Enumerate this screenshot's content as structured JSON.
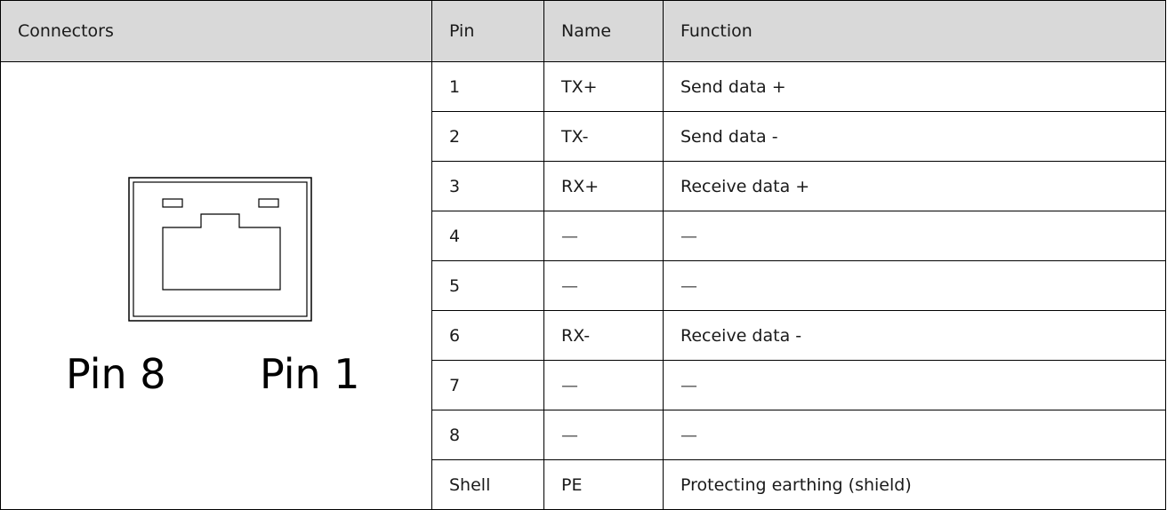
{
  "table": {
    "headers": {
      "connectors": "Connectors",
      "pin": "Pin",
      "name": "Name",
      "function": "Function"
    },
    "connector_labels": {
      "left": "Pin 8",
      "right": "Pin 1"
    },
    "rows": [
      {
        "pin": "1",
        "name": "TX+",
        "function": "Send data +"
      },
      {
        "pin": "2",
        "name": "TX-",
        "function": "Send data -"
      },
      {
        "pin": "3",
        "name": "RX+",
        "function": "Receive data +"
      },
      {
        "pin": "4",
        "name": "—",
        "function": "—"
      },
      {
        "pin": "5",
        "name": "—",
        "function": "—"
      },
      {
        "pin": "6",
        "name": "RX-",
        "function": "Receive data -"
      },
      {
        "pin": "7",
        "name": "—",
        "function": "—"
      },
      {
        "pin": "8",
        "name": "—",
        "function": "—"
      },
      {
        "pin": "Shell",
        "name": "PE",
        "function": "Protecting earthing (shield)"
      }
    ]
  }
}
